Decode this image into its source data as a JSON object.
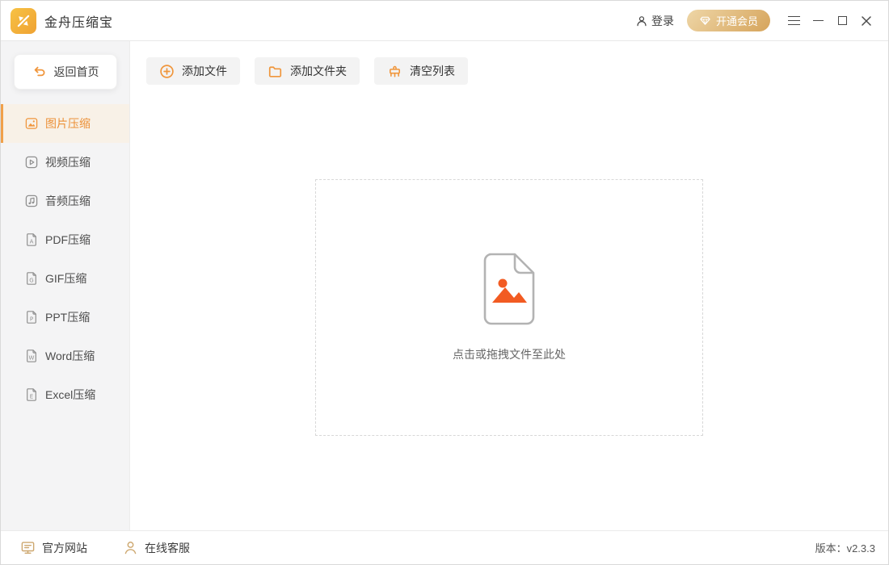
{
  "window": {
    "title": "金舟压缩宝"
  },
  "titlebar": {
    "login_label": "登录",
    "vip_label": "开通会员"
  },
  "sidebar": {
    "back_label": "返回首页",
    "items": [
      {
        "key": "image",
        "label": "图片压缩",
        "icon": "image-icon",
        "selected": true
      },
      {
        "key": "video",
        "label": "视频压缩",
        "icon": "video-icon",
        "selected": false
      },
      {
        "key": "audio",
        "label": "音频压缩",
        "icon": "audio-icon",
        "selected": false
      },
      {
        "key": "pdf",
        "label": "PDF压缩",
        "icon": "pdf-icon",
        "selected": false
      },
      {
        "key": "gif",
        "label": "GIF压缩",
        "icon": "gif-icon",
        "selected": false
      },
      {
        "key": "ppt",
        "label": "PPT压缩",
        "icon": "ppt-icon",
        "selected": false
      },
      {
        "key": "word",
        "label": "Word压缩",
        "icon": "word-icon",
        "selected": false
      },
      {
        "key": "excel",
        "label": "Excel压缩",
        "icon": "excel-icon",
        "selected": false
      }
    ]
  },
  "toolbar": {
    "add_file": "添加文件",
    "add_folder": "添加文件夹",
    "clear_list": "清空列表"
  },
  "dropzone": {
    "hint": "点击或拖拽文件至此处"
  },
  "footer": {
    "website": "官方网站",
    "support": "在线客服",
    "version": "版本：v2.3.3"
  },
  "colors": {
    "accent_orange": "#f0963c",
    "selected_bg": "#f8f1e7",
    "selected_bar": "#f0a04a",
    "vip_gold_light": "#eed6a7",
    "vip_gold_dark": "#d6a45b",
    "dropzone_image": "#f25b22",
    "footer_icon_tan": "#cda76f",
    "sidebar_bg": "#f4f4f5"
  }
}
